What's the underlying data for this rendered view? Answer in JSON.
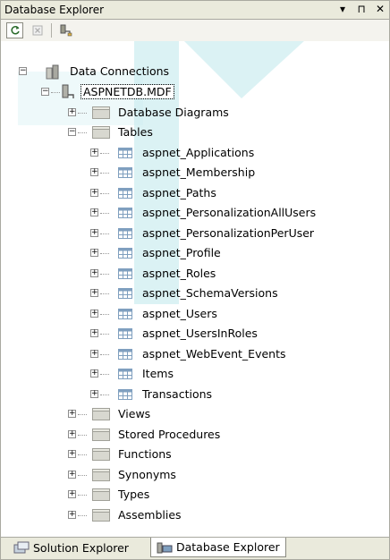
{
  "window": {
    "title": "Database Explorer",
    "controls": [
      "▾",
      "⊓",
      "✕"
    ]
  },
  "toolbar": {
    "buttons": [
      "refresh-icon",
      "stop-icon",
      "connect-to-database-icon"
    ]
  },
  "tree": {
    "root": {
      "label": "Data Connections",
      "icon": "data-connections-icon"
    },
    "connection": {
      "label": "ASPNETDB.MDF",
      "icon": "database-connection-icon"
    },
    "database_diagrams": {
      "label": "Database Diagrams"
    },
    "tables": {
      "label": "Tables"
    },
    "table_items": [
      "aspnet_Applications",
      "aspnet_Membership",
      "aspnet_Paths",
      "aspnet_PersonalizationAllUsers",
      "aspnet_PersonalizationPerUser",
      "aspnet_Profile",
      "aspnet_Roles",
      "aspnet_SchemaVersions",
      "aspnet_Users",
      "aspnet_UsersInRoles",
      "aspnet_WebEvent_Events",
      "Items",
      "Transactions"
    ],
    "folders": [
      "Views",
      "Stored Procedures",
      "Functions",
      "Synonyms",
      "Types",
      "Assemblies"
    ]
  },
  "tabs": [
    {
      "label": "Solution Explorer",
      "icon": "solution-explorer-icon",
      "active": false
    },
    {
      "label": "Database Explorer",
      "icon": "database-explorer-icon",
      "active": true
    }
  ],
  "colors": {
    "watermark": "#cfeef0",
    "folder": "#d8d8d0",
    "table_icon": "#7f9fbf"
  }
}
